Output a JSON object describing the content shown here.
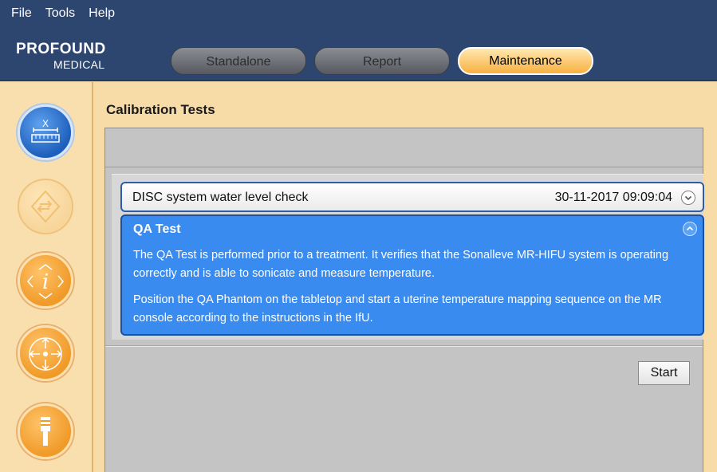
{
  "menu": {
    "file": "File",
    "tools": "Tools",
    "help": "Help"
  },
  "logo": {
    "top": "PROFOUND",
    "bottom": "MEDICAL"
  },
  "tabs": {
    "standalone": "Standalone",
    "report": "Report",
    "maintenance": "Maintenance",
    "active": "Maintenance"
  },
  "sidebar": {
    "items": [
      {
        "icon": "ruler-icon",
        "state": "active"
      },
      {
        "icon": "direction-icon",
        "state": "disabled"
      },
      {
        "icon": "info-icon",
        "state": "enabled"
      },
      {
        "icon": "move-icon",
        "state": "enabled"
      },
      {
        "icon": "transducer-icon",
        "state": "enabled"
      }
    ],
    "ruler_label": "X"
  },
  "main": {
    "title": "Calibration Tests",
    "tests": [
      {
        "name": "DISC system water level check",
        "timestamp": "30-11-2017 09:09:04",
        "expanded": false
      },
      {
        "name": "QA Test",
        "expanded": true,
        "description": [
          "The QA Test is performed prior to a treatment. It verifies that the Sonalleve MR-HIFU system is operating correctly and is able to sonicate and measure temperature.",
          "Position the QA Phantom on the tabletop and start a uterine temperature mapping sequence on the MR console according to the instructions in the IfU."
        ]
      }
    ],
    "start_label": "Start"
  },
  "colors": {
    "header": "#2c4670",
    "accent_blue": "#3a8bf0",
    "accent_orange": "#f09a28",
    "background": "#f7dca8"
  }
}
